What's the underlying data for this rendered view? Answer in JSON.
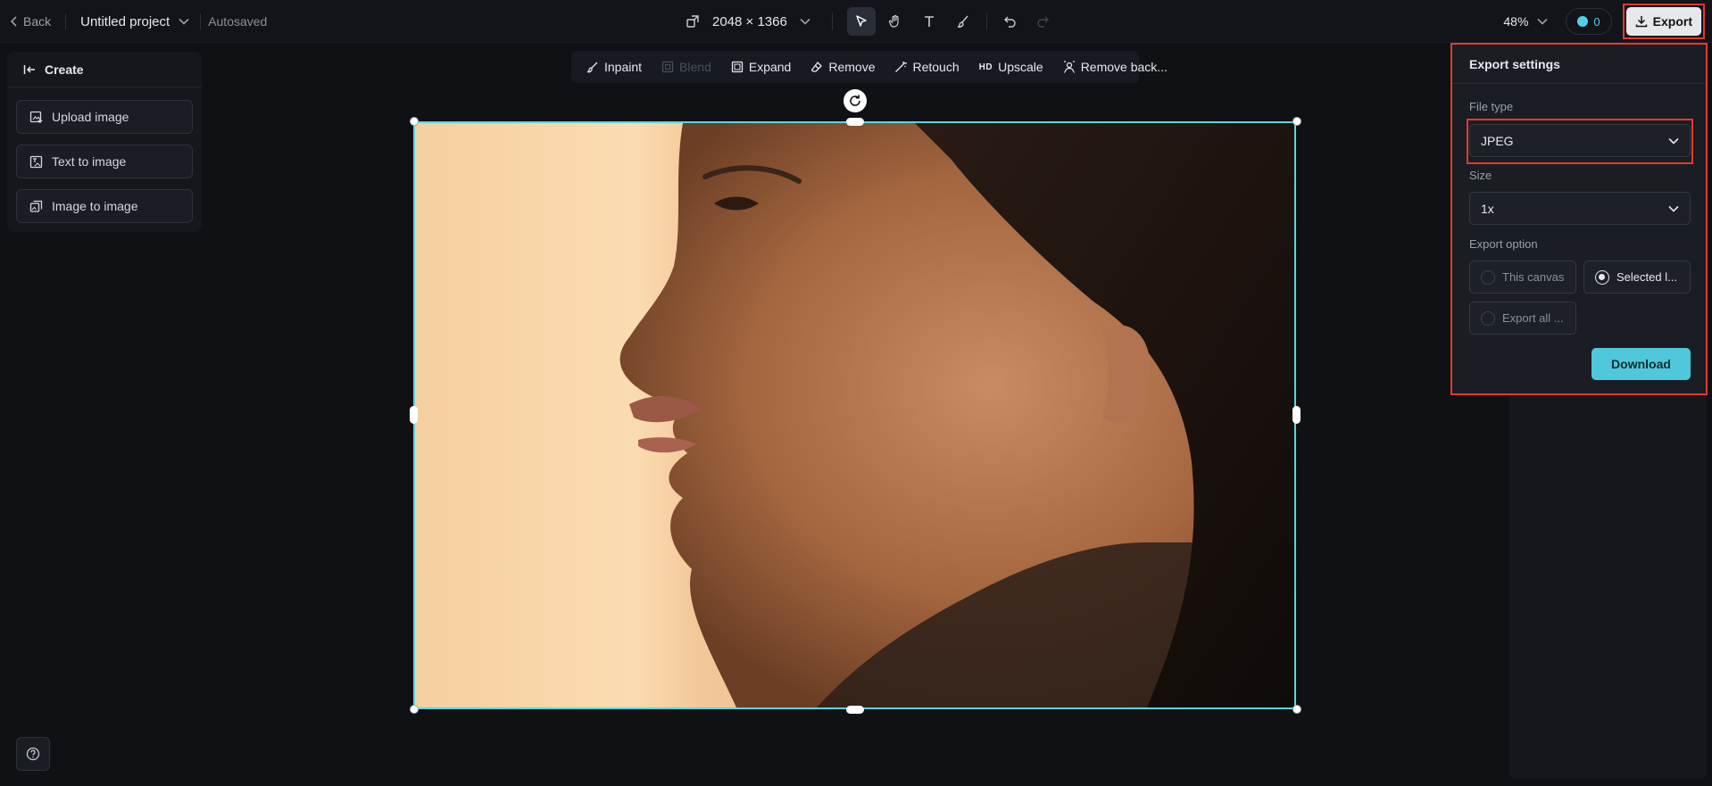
{
  "topbar": {
    "back_label": "Back",
    "project_name": "Untitled project",
    "autosave_status": "Autosaved",
    "canvas_dimensions": "2048 × 1366",
    "zoom": "48%",
    "credits": "0",
    "export_label": "Export"
  },
  "left_panel": {
    "header": "Create",
    "items": [
      {
        "label": "Upload image",
        "icon": "upload-image-icon"
      },
      {
        "label": "Text to image",
        "icon": "text-to-image-icon"
      },
      {
        "label": "Image to image",
        "icon": "image-to-image-icon"
      }
    ]
  },
  "edit_toolbar": {
    "items": [
      {
        "label": "Inpaint",
        "enabled": true
      },
      {
        "label": "Blend",
        "enabled": false
      },
      {
        "label": "Expand",
        "enabled": true
      },
      {
        "label": "Remove",
        "enabled": true
      },
      {
        "label": "Retouch",
        "enabled": true
      },
      {
        "label": "Upscale",
        "badge": "HD",
        "enabled": true
      },
      {
        "label": "Remove back...",
        "enabled": true
      }
    ]
  },
  "export_settings": {
    "title": "Export settings",
    "file_type_label": "File type",
    "file_type_value": "JPEG",
    "size_label": "Size",
    "size_value": "1x",
    "export_option_label": "Export option",
    "options": [
      {
        "label": "This canvas",
        "selected": false
      },
      {
        "label": "Selected l...",
        "selected": true
      },
      {
        "label": "Export all ...",
        "selected": false
      }
    ],
    "download_label": "Download"
  },
  "colors": {
    "accent": "#4fc8dc",
    "selection": "#5ad6df",
    "highlight": "#e5392c",
    "background": "#0f1115"
  }
}
